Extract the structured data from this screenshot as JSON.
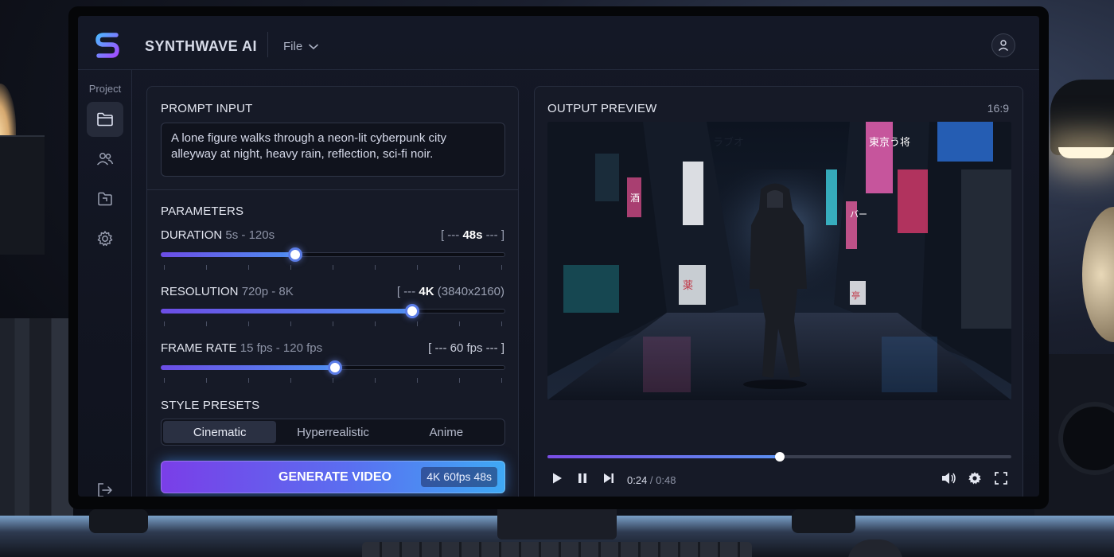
{
  "app": {
    "name": "SYNTHWAVE AI",
    "menu_file": "File"
  },
  "sidebar": {
    "title": "Project",
    "items": [
      {
        "name": "folder-icon",
        "active": true
      },
      {
        "name": "users-icon",
        "active": false
      },
      {
        "name": "file-icon",
        "active": false
      },
      {
        "name": "gear-icon",
        "active": false
      }
    ],
    "logout": "logout-icon"
  },
  "prompt": {
    "title": "PROMPT INPUT",
    "text": "A lone figure walks through a neon-lit cyberpunk city alleyway at night, heavy rain, reflection, sci-fi noir."
  },
  "parameters": {
    "title": "PARAMETERS",
    "duration": {
      "label": "DURATION",
      "range": "5s - 120s",
      "value_prefix": "[ --- ",
      "value": "48s",
      "value_suffix": " --- ]",
      "fraction": 0.39
    },
    "resolution": {
      "label": "RESOLUTION",
      "range": "720p - 8K",
      "value_prefix": "[ --- ",
      "value": "4K",
      "value_detail": " (3840x2160)",
      "fraction": 0.73
    },
    "frame_rate": {
      "label": "FRAME RATE",
      "range": "15 fps - 120 fps",
      "value": "[ --- 60 fps --- ]",
      "fraction": 0.505
    }
  },
  "presets": {
    "title": "STYLE PRESETS",
    "options": [
      "Cinematic",
      "Hyperrealistic",
      "Anime"
    ],
    "selected": "Cinematic"
  },
  "generate": {
    "label": "GENERATE VIDEO",
    "badge": "4K 60fps 48s"
  },
  "preview": {
    "title": "OUTPUT PREVIEW",
    "aspect": "16:9",
    "signs": [
      "ラブオ",
      "東京う将",
      "酒",
      "バー",
      "薬",
      "亭"
    ],
    "progress": 0.5,
    "time_current": "0:24",
    "time_separator": " / ",
    "time_total": "0:48"
  },
  "colors": {
    "accent_purple": "#7a3ee8",
    "accent_blue": "#3fa9f5",
    "panel_bg": "#161a27"
  }
}
